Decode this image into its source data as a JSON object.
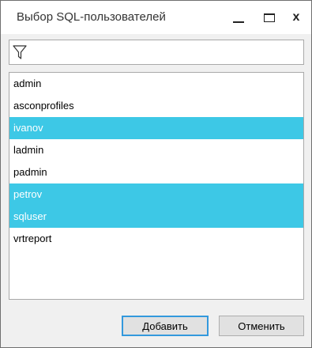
{
  "window": {
    "title": "Выбор SQL-пользователей",
    "controls": {
      "minimize_icon": "minimize-icon",
      "maximize_icon": "maximize-icon",
      "close_glyph": "x"
    }
  },
  "filter": {
    "icon": "filter-funnel-icon",
    "value": "",
    "placeholder": ""
  },
  "users": [
    {
      "name": "admin",
      "selected": false
    },
    {
      "name": "asconprofiles",
      "selected": false
    },
    {
      "name": "ivanov",
      "selected": true
    },
    {
      "name": "ladmin",
      "selected": false
    },
    {
      "name": "padmin",
      "selected": false
    },
    {
      "name": "petrov",
      "selected": true
    },
    {
      "name": "sqluser",
      "selected": true
    },
    {
      "name": "vrtreport",
      "selected": false
    }
  ],
  "buttons": {
    "add_label": "Добавить",
    "cancel_label": "Отменить"
  },
  "colors": {
    "selection": "#3dc8e6",
    "default_button_border": "#3399dd"
  }
}
